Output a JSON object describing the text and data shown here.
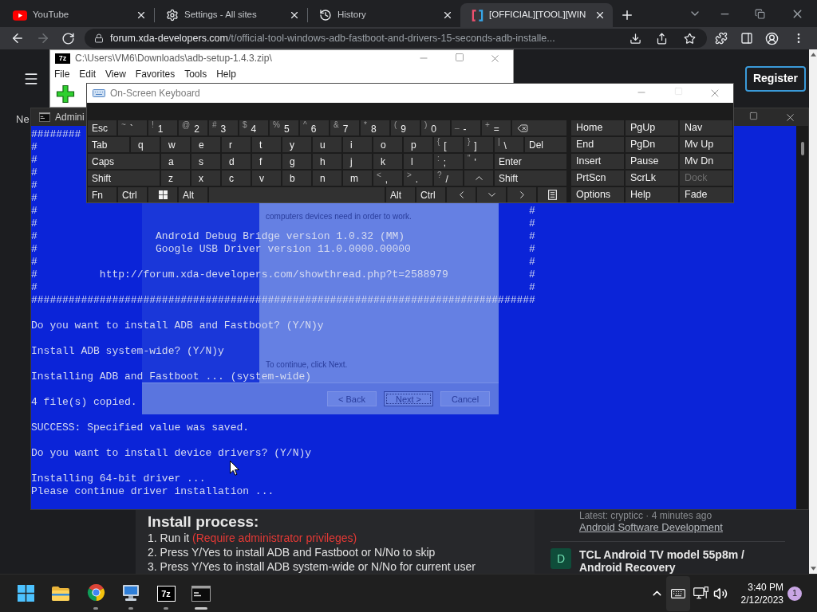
{
  "browser": {
    "tabs": [
      {
        "kind": "youtube",
        "title": "YouTube",
        "selected": false
      },
      {
        "kind": "settings",
        "title": "Settings - All sites",
        "selected": false
      },
      {
        "kind": "history",
        "title": "History",
        "selected": false
      },
      {
        "kind": "xda",
        "title": "[OFFICIAL][TOOL][WIN",
        "selected": true
      }
    ],
    "back_disabled": false,
    "forward_disabled": true,
    "address": {
      "host": "forum.xda-developers.com",
      "path": "/t/official-tool-windows-adb-fastboot-and-drivers-15-seconds-adb-installe..."
    },
    "page": {
      "register": "Register",
      "nav_partial": "Ne",
      "post": {
        "heading": "Install process:",
        "steps": [
          {
            "text": "1. Run it",
            "note": "(Require administrator privileges)"
          },
          {
            "text": "2. Press Y/Yes to install ADB and Fastboot or N/No to skip"
          },
          {
            "text": "3. Press Y/Yes to install ADB system-wide or N/No for current user"
          }
        ]
      },
      "sidebar": {
        "latest": "Latest: crypticc · 4 minutes ago",
        "forum": "Android Software Development",
        "thread": {
          "avatar": "D",
          "title": "TCL Android TV model 55p8m / Android Recovery"
        }
      }
    }
  },
  "archive_window": {
    "logo": "7z",
    "title": "C:\\Users\\VM6\\Downloads\\adb-setup-1.4.3.zip\\",
    "menu": [
      "File",
      "Edit",
      "View",
      "Favorites",
      "Tools",
      "Help"
    ]
  },
  "console": {
    "title": "Admini",
    "banner": [
      {
        "text": "########"
      },
      {
        "text": "#"
      },
      {
        "text": "#"
      },
      {
        "text": "#"
      },
      {
        "text": "#"
      },
      {
        "text": "#"
      },
      {
        "text": "#",
        "end": "#"
      },
      {
        "text": "#",
        "end": "#"
      },
      {
        "text": "#                   Android Debug Bridge version 1.0.32 (MM)",
        "end": "#"
      },
      {
        "text": "#                   Google USB Driver version 11.0.0000.00000",
        "end": "#"
      },
      {
        "text": "#",
        "end": "#"
      },
      {
        "text": "#          http://forum.xda-developers.com/showthread.php?t=2588979",
        "end": "#"
      },
      {
        "text": "#",
        "end": "#"
      },
      {
        "text": "#################################################################################"
      }
    ],
    "output": [
      [
        "Do you want to install ADB and Fastboot? (Y/N)y"
      ],
      [
        "Install ADB system-wide? (Y/N)y"
      ],
      [
        "Installing ADB and Fastboot ... (system-wide)"
      ],
      [
        "4 file(s) copied."
      ],
      [
        "SUCCESS: Specified value was saved."
      ],
      [
        "Do you want to install device drivers? (Y/N)y"
      ],
      [
        "Installing 64-bit driver ...",
        "Please continue driver installation ..."
      ]
    ],
    "wizard": {
      "text": "computers devices need in order to work.",
      "prompt": "To continue, click Next.",
      "buttons": [
        {
          "label": "< Back",
          "focused": false
        },
        {
          "label": "Next >",
          "focused": true
        },
        {
          "label": "Cancel",
          "focused": false
        }
      ]
    }
  },
  "keyboard": {
    "title": "On-Screen Keyboard",
    "maximize_disabled": true,
    "rows": [
      {
        "keys": [
          {
            "kind": "fn",
            "label": "Esc"
          },
          {
            "kind": "char",
            "shift": "~",
            "label": "`"
          },
          {
            "kind": "char",
            "shift": "!",
            "label": "1"
          },
          {
            "kind": "char",
            "shift": "@",
            "label": "2"
          },
          {
            "kind": "char",
            "shift": "#",
            "label": "3"
          },
          {
            "kind": "char",
            "shift": "$",
            "label": "4"
          },
          {
            "kind": "char",
            "shift": "%",
            "label": "5"
          },
          {
            "kind": "char",
            "shift": "^",
            "label": "6"
          },
          {
            "kind": "char",
            "shift": "&",
            "label": "7"
          },
          {
            "kind": "char",
            "shift": "*",
            "label": "8"
          },
          {
            "kind": "char",
            "shift": "(",
            "label": "9"
          },
          {
            "kind": "char",
            "shift": ")",
            "label": "0"
          },
          {
            "kind": "char",
            "shift": "_",
            "label": "-"
          },
          {
            "kind": "char",
            "shift": "+",
            "label": "="
          },
          {
            "kind": "backspace"
          }
        ]
      },
      {
        "keys": [
          {
            "kind": "mod",
            "label": "Tab"
          },
          {
            "kind": "char",
            "label": "q"
          },
          {
            "kind": "char",
            "label": "w"
          },
          {
            "kind": "char",
            "label": "e"
          },
          {
            "kind": "char",
            "label": "r"
          },
          {
            "kind": "char",
            "label": "t"
          },
          {
            "kind": "char",
            "label": "y"
          },
          {
            "kind": "char",
            "label": "u"
          },
          {
            "kind": "char",
            "label": "i"
          },
          {
            "kind": "char",
            "label": "o"
          },
          {
            "kind": "char",
            "label": "p"
          },
          {
            "kind": "char",
            "shift": "{",
            "label": "["
          },
          {
            "kind": "char",
            "shift": "}",
            "label": "]"
          },
          {
            "kind": "char",
            "shift": "|",
            "label": "\\"
          },
          {
            "kind": "mod",
            "label": "Del"
          }
        ]
      },
      {
        "keys": [
          {
            "kind": "mod",
            "label": "Caps"
          },
          {
            "kind": "char",
            "label": "a"
          },
          {
            "kind": "char",
            "label": "s"
          },
          {
            "kind": "char",
            "label": "d"
          },
          {
            "kind": "char",
            "label": "f"
          },
          {
            "kind": "char",
            "label": "g"
          },
          {
            "kind": "char",
            "label": "h"
          },
          {
            "kind": "char",
            "label": "j"
          },
          {
            "kind": "char",
            "label": "k"
          },
          {
            "kind": "char",
            "label": "l"
          },
          {
            "kind": "char",
            "shift": ":",
            "label": ";"
          },
          {
            "kind": "char",
            "shift": "\"",
            "label": "'"
          },
          {
            "kind": "mod",
            "label": "Enter"
          }
        ]
      },
      {
        "keys": [
          {
            "kind": "mod",
            "label": "Shift"
          },
          {
            "kind": "char",
            "label": "z"
          },
          {
            "kind": "char",
            "label": "x"
          },
          {
            "kind": "char",
            "label": "c"
          },
          {
            "kind": "char",
            "label": "v"
          },
          {
            "kind": "char",
            "label": "b"
          },
          {
            "kind": "char",
            "label": "n"
          },
          {
            "kind": "char",
            "label": "m"
          },
          {
            "kind": "char",
            "shift": "<",
            "label": ","
          },
          {
            "kind": "char",
            "shift": ">",
            "label": "."
          },
          {
            "kind": "char",
            "shift": "?",
            "label": "/"
          },
          {
            "kind": "up"
          },
          {
            "kind": "mod",
            "label": "Shift"
          }
        ]
      },
      {
        "keys": [
          {
            "kind": "fn",
            "label": "Fn"
          },
          {
            "kind": "fn",
            "label": "Ctrl"
          },
          {
            "kind": "windows"
          },
          {
            "kind": "fn",
            "label": "Alt"
          },
          {
            "kind": "space"
          },
          {
            "kind": "fn",
            "label": "Alt"
          },
          {
            "kind": "fn",
            "label": "Ctrl"
          },
          {
            "kind": "left"
          },
          {
            "kind": "down"
          },
          {
            "kind": "right"
          },
          {
            "kind": "menu"
          }
        ]
      }
    ],
    "nav": [
      [
        {
          "label": "Home",
          "disabled": false
        },
        {
          "label": "PgUp",
          "disabled": false
        },
        {
          "label": "Nav",
          "disabled": false
        }
      ],
      [
        {
          "label": "End",
          "disabled": false
        },
        {
          "label": "PgDn",
          "disabled": false
        },
        {
          "label": "Mv Up",
          "disabled": false
        }
      ],
      [
        {
          "label": "Insert",
          "disabled": false
        },
        {
          "label": "Pause",
          "disabled": false
        },
        {
          "label": "Mv Dn",
          "disabled": false
        }
      ],
      [
        {
          "label": "PrtScn",
          "disabled": false
        },
        {
          "label": "ScrLk",
          "disabled": false
        },
        {
          "label": "Dock",
          "disabled": true
        }
      ],
      [
        {
          "label": "Options",
          "disabled": false
        },
        {
          "label": "Help",
          "disabled": false
        },
        {
          "label": "Fade",
          "disabled": false
        }
      ]
    ]
  },
  "taskbar": {
    "apps": [
      {
        "kind": "start",
        "running": false,
        "active": false
      },
      {
        "kind": "explorer",
        "running": false,
        "active": false
      },
      {
        "kind": "chrome",
        "running": true,
        "active": false
      },
      {
        "kind": "remote",
        "running": true,
        "active": false
      },
      {
        "kind": "archiver",
        "label": "7z",
        "running": true,
        "active": false
      },
      {
        "kind": "console",
        "running": true,
        "active": true
      }
    ],
    "tray": [
      {
        "kind": "overflow",
        "highlighted": false
      },
      {
        "kind": "keyboard",
        "highlighted": true
      },
      {
        "kind": "network",
        "highlighted": false
      },
      {
        "kind": "volume",
        "highlighted": false
      }
    ],
    "time": "3:40 PM",
    "date": "2/12/2023",
    "notifications": "1"
  }
}
